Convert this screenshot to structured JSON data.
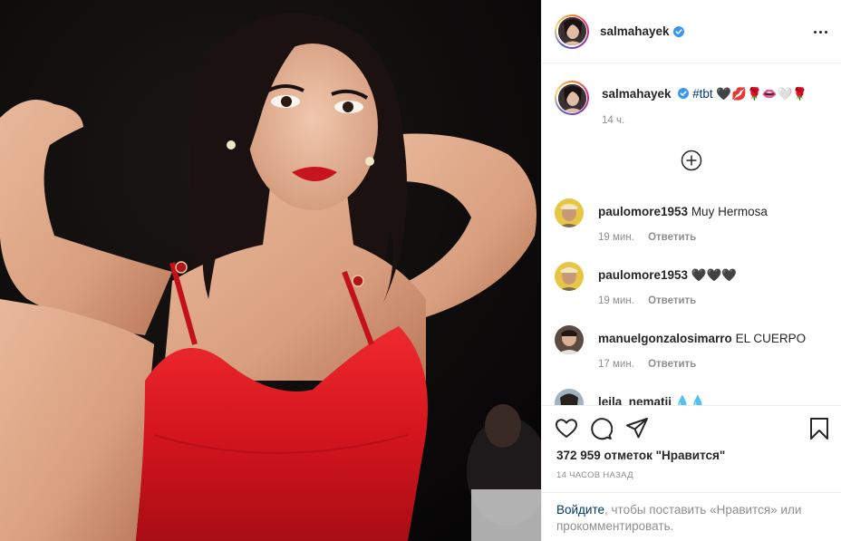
{
  "post": {
    "author": "salmahayek",
    "verified": true,
    "more_options": "more-options",
    "photo_subject": "woman-in-red-dress"
  },
  "caption": {
    "username": "salmahayek",
    "hashtag": "#tbt",
    "emojis": "🖤💋🌹👄🤍🌹",
    "time": "14 ч."
  },
  "load_more_icon": "plus-circle-icon",
  "comments": [
    {
      "username": "paulomore1953",
      "text": "Muy Hermosa",
      "time": "19 мин.",
      "reply": "Ответить"
    },
    {
      "username": "paulomore1953",
      "text": "🖤🖤🖤",
      "time": "19 мин.",
      "reply": "Ответить"
    },
    {
      "username": "manuelgonzalosimarro",
      "text": "EL CUERPO",
      "time": "17 мин.",
      "reply": "Ответить"
    },
    {
      "username": "leila_nematii",
      "text": "💧💧",
      "time": "",
      "reply": ""
    }
  ],
  "actions": {
    "like": "heart-icon",
    "comment": "comment-icon",
    "share": "send-icon",
    "save": "bookmark-icon"
  },
  "likes_text": "372 959 отметок \"Нравится\"",
  "posted_ago": "14 часов назад",
  "login_prompt": {
    "link": "Войдите",
    "rest": ", чтобы поставить «Нравится» или прокомментировать."
  },
  "colors": {
    "verified_blue": "#3897f0",
    "link": "#00376b",
    "muted": "#8e8e8e",
    "dress_red": "#d4151e"
  }
}
